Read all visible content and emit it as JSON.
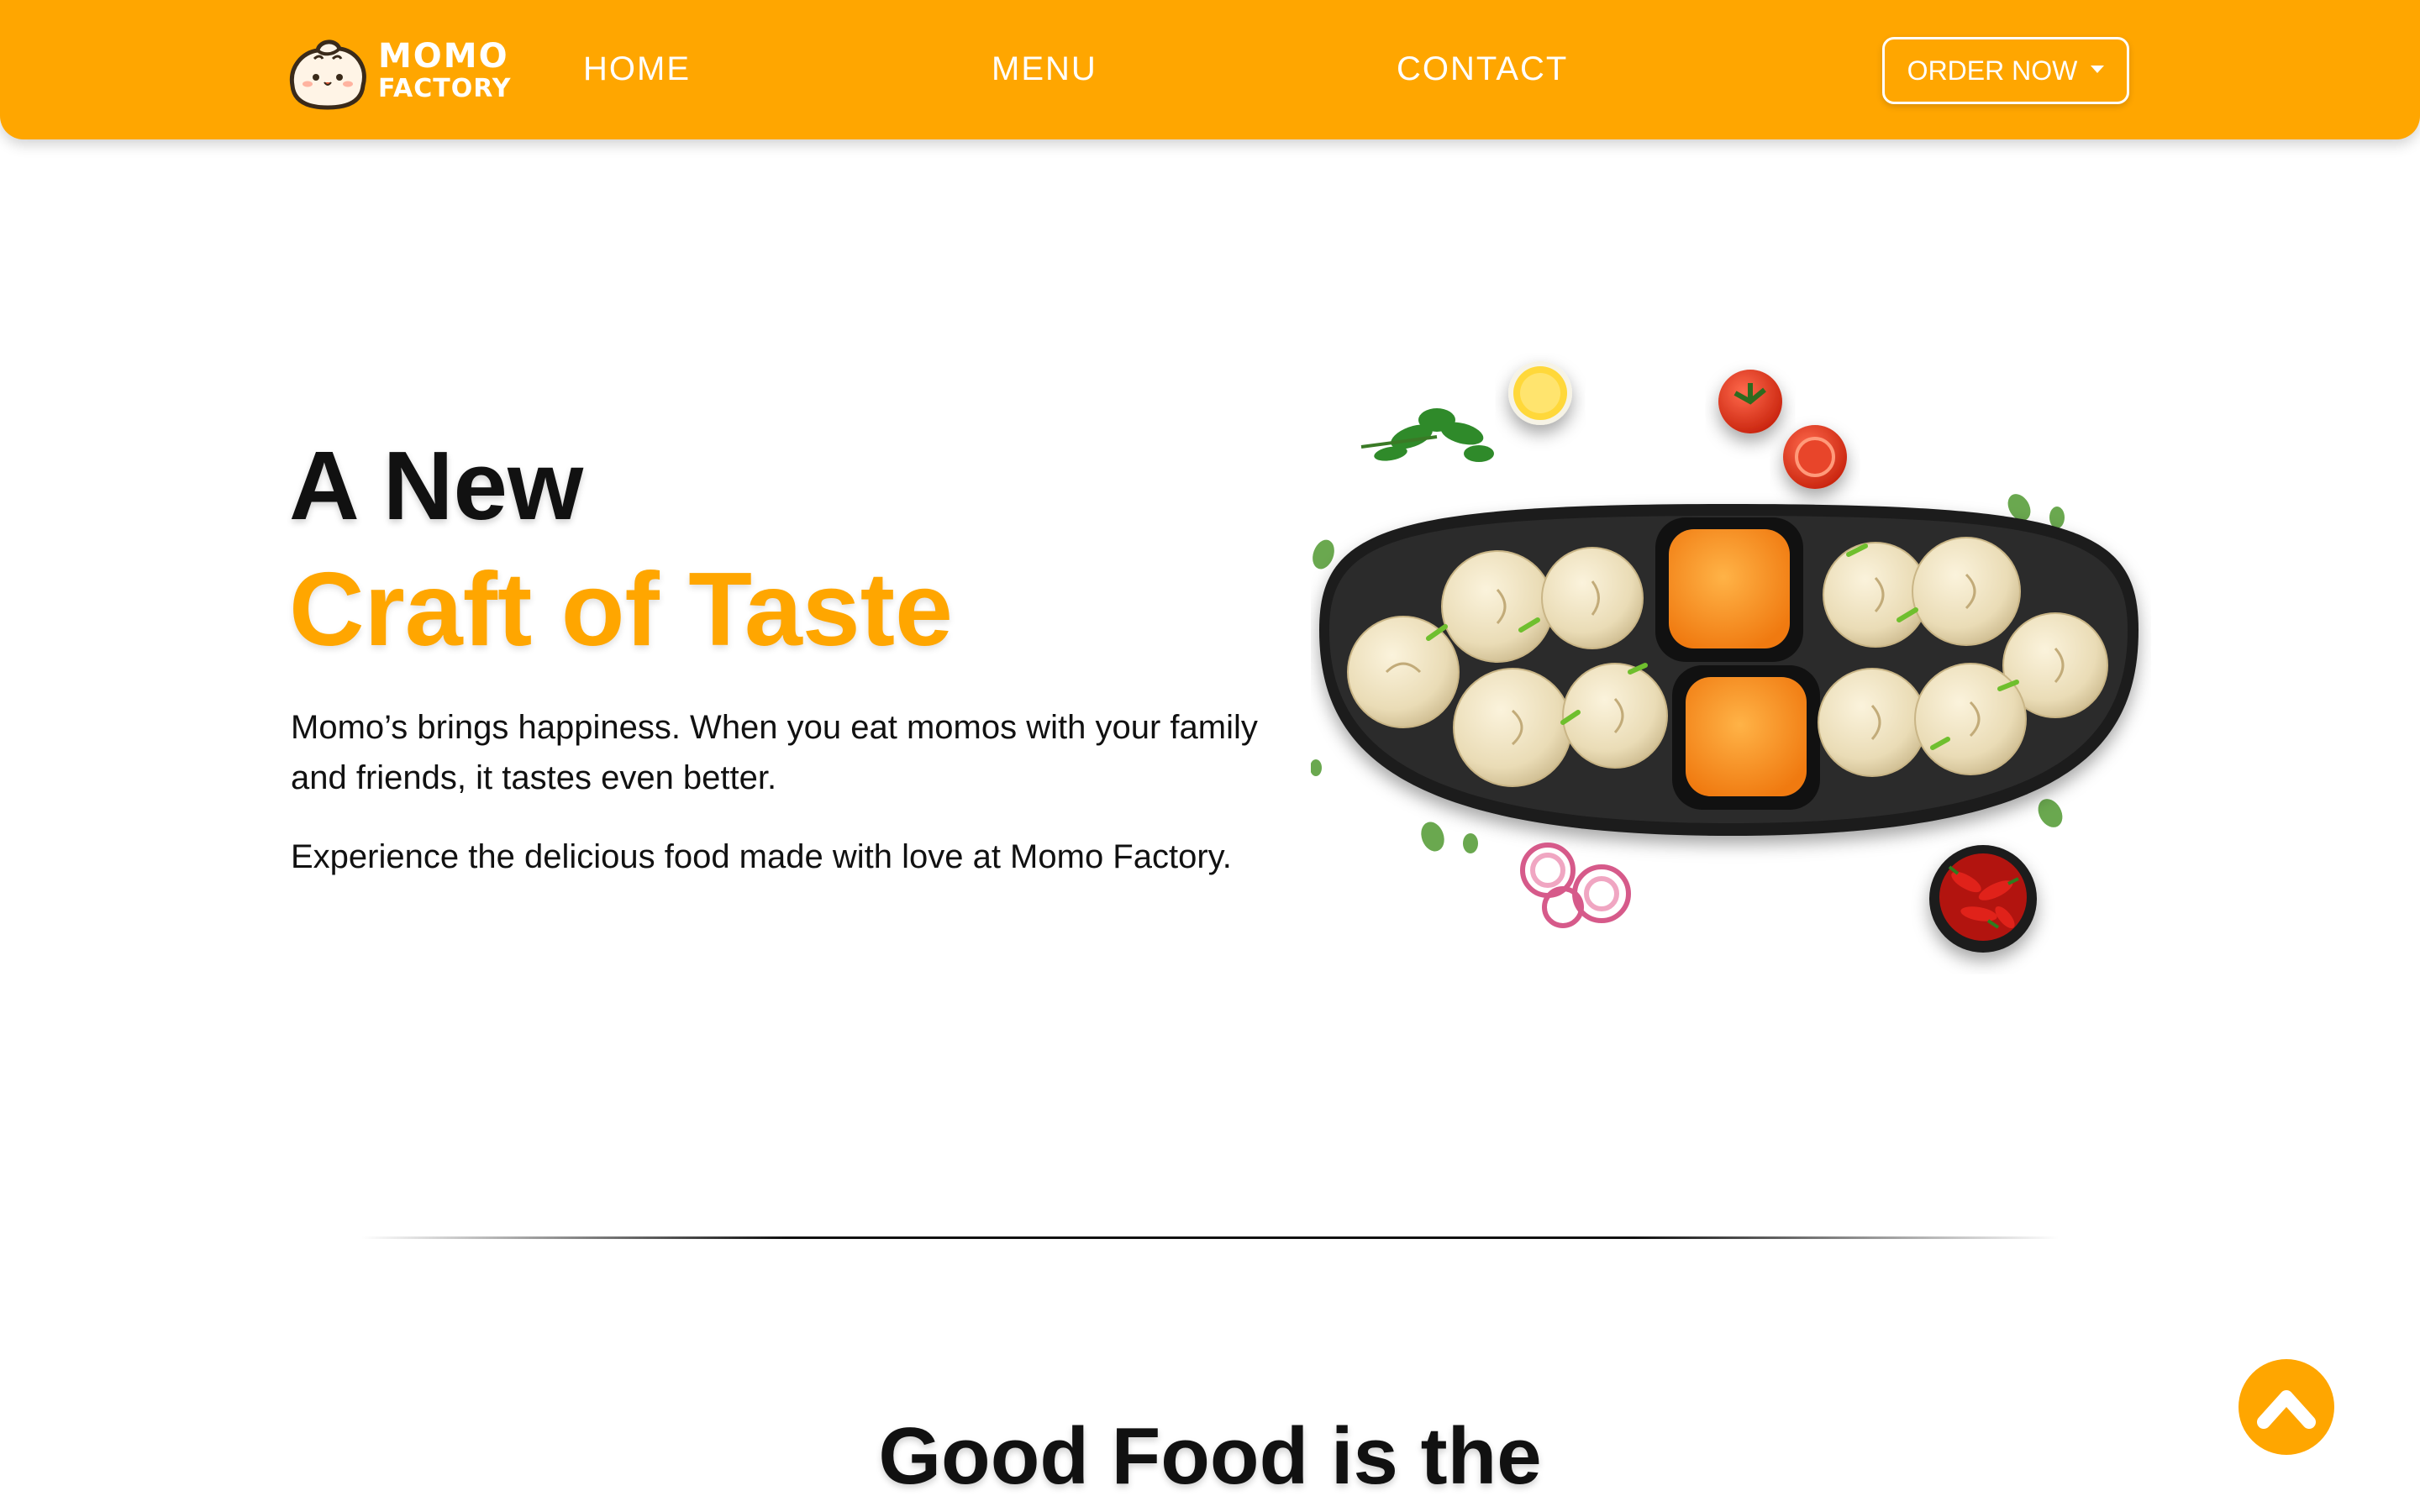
{
  "brand": {
    "line1": "MOMO",
    "line2": "FACTORY",
    "logo_icon": "dumpling-mascot-icon"
  },
  "nav": {
    "items": [
      {
        "label": "HOME"
      },
      {
        "label": "MENU"
      },
      {
        "label": "CONTACT"
      }
    ],
    "order_button": {
      "label": "ORDER NOW",
      "icon": "caret-down-icon"
    }
  },
  "hero": {
    "title_line1": "A New",
    "title_line2": "Craft of Taste",
    "paragraph1": "Momo’s brings happiness. When you eat momos with your family and friends, it tastes even better.",
    "paragraph2": "Experience the delicious food made with love at Momo Factory.",
    "image_icon": "momo-platter-image"
  },
  "section2": {
    "title": "Good Food is the"
  },
  "scroll_top": {
    "icon": "chevron-up-icon"
  },
  "colors": {
    "accent": "#ffa600",
    "text": "#111111",
    "background": "#ffffff"
  }
}
